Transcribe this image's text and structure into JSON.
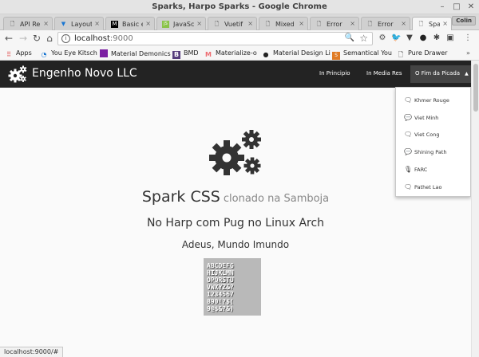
{
  "window": {
    "title": "Sparks, Harpo Sparks - Google Chrome",
    "profile": "Colin"
  },
  "tabs": [
    {
      "label": "API Re",
      "icon": "document-icon",
      "active": false
    },
    {
      "label": "Layout",
      "icon": "vuetify-icon",
      "active": false
    },
    {
      "label": "Basic e",
      "icon": "medium-icon",
      "active": false
    },
    {
      "label": "JavaSc",
      "icon": "js-icon",
      "active": false
    },
    {
      "label": "Vuetif",
      "icon": "document-icon",
      "active": false
    },
    {
      "label": "Mixed",
      "icon": "document-icon",
      "active": false
    },
    {
      "label": "Error",
      "icon": "document-icon",
      "active": false
    },
    {
      "label": "Error",
      "icon": "document-icon",
      "active": false
    },
    {
      "label": "Sparks",
      "icon": "document-icon",
      "active": true
    }
  ],
  "address": {
    "host": "localhost",
    "port": ":9000"
  },
  "bookmarks": [
    {
      "label": "Apps",
      "icon": "apps-grid-icon"
    },
    {
      "label": "You Eye Kitsch",
      "icon": "loading-icon"
    },
    {
      "label": "Material Demonics",
      "icon": "purple-square-icon"
    },
    {
      "label": "BMD",
      "icon": "bootstrap-icon"
    },
    {
      "label": "Materialize-o",
      "icon": "materialize-icon"
    },
    {
      "label": "Material Design Li",
      "icon": "github-icon"
    },
    {
      "label": "Semantical You",
      "icon": "semantic-icon"
    },
    {
      "label": "Pure Drawer",
      "icon": "document-icon"
    }
  ],
  "navbar": {
    "brand": "Engenho Novo LLC",
    "links": [
      "In Principio",
      "In Media Res",
      "O Fim da Picada"
    ]
  },
  "dropdown": {
    "items": [
      {
        "label": "Khmer Rouge",
        "icon": "comment-outline-icon"
      },
      {
        "label": "Viet Minh",
        "icon": "comment-icon"
      },
      {
        "label": "Viet Cong",
        "icon": "comments-outline-icon"
      },
      {
        "label": "Shining Path",
        "icon": "comments-icon"
      },
      {
        "label": "FARC",
        "icon": "microphone-icon"
      },
      {
        "label": "Pathet Lao",
        "icon": "comment-outline-icon"
      }
    ]
  },
  "hero": {
    "title": "Spark CSS",
    "title_sub": "clonado na Samboja",
    "subtitle": "No Harp com Pug no Linux Arch",
    "subtitle2": "Adeus, Mundo Imundo",
    "type_rows": [
      "ABCDEFG",
      "HIJKLMN",
      "OPQRSTU",
      "VWXYZ&?",
      "1234567",
      "890!?$(",
      "9@$&?&)"
    ]
  },
  "status": {
    "url": "localhost:9000/#"
  },
  "colors": {
    "navbar": "#232323",
    "page_bg": "#fafafa",
    "chrome_bg": "#f6f6f6"
  }
}
